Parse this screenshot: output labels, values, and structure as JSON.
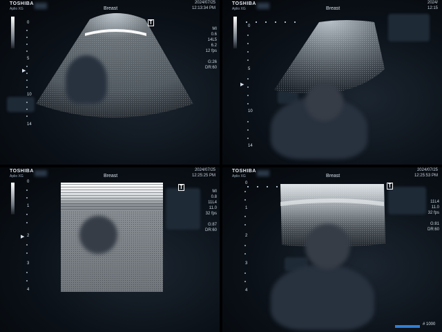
{
  "panels": [
    {
      "brand": "TOSHIBA",
      "model": "Aplio XG",
      "preset": "Breast",
      "date": "2024/07/25",
      "time": "12:13:34 PM",
      "params": [
        "MI",
        "0.6",
        "14L5",
        "6.2",
        "12 fps",
        "",
        "G:26",
        "DR:60"
      ],
      "depth_labels": [
        "0",
        "5",
        "10",
        "14"
      ],
      "shape": "convex"
    },
    {
      "brand": "TOSHIBA",
      "model": "Aplio XG",
      "preset": "Breast",
      "date": "2024/",
      "time": "12:15",
      "params": [],
      "depth_labels": [
        "0",
        "5",
        "10",
        "14"
      ],
      "shape": "convex-wide"
    },
    {
      "brand": "TOSHIBA",
      "model": "Aplio XG",
      "preset": "Breast",
      "date": "2024/07/25",
      "time": "12:25:25 PM",
      "params": [
        "MI",
        "0.8",
        "11L4",
        "11.0",
        "32 fps",
        "",
        "G:87",
        "DR:60"
      ],
      "depth_labels": [
        "0",
        "1",
        "2",
        "3",
        "4"
      ],
      "shape": "linear"
    },
    {
      "brand": "TOSHIBA",
      "model": "Aplio XG",
      "preset": "Breast",
      "date": "2024/07/25",
      "time": "12:25:53 PM",
      "params": [
        "",
        "11L4",
        "11.0",
        "32 fps",
        "",
        "G:81",
        "DR:60"
      ],
      "depth_labels": [
        "0",
        "1",
        "2",
        "3",
        "4"
      ],
      "shape": "linear-wide"
    }
  ],
  "marker": "T",
  "focus_marker": "▶",
  "cine": {
    "label": "# 1000",
    "colors": {
      "bar": "#2f7fd6"
    }
  }
}
